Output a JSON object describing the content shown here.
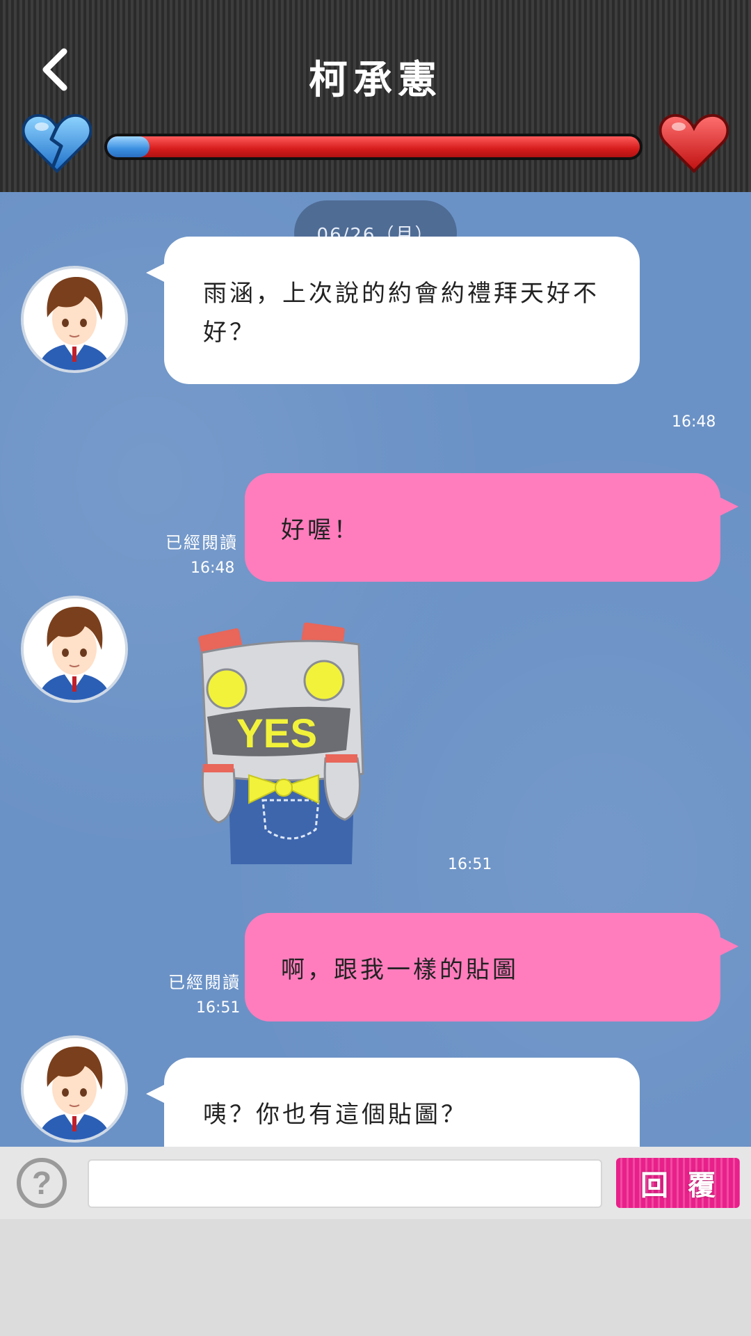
{
  "header": {
    "title": "柯承憲",
    "back_icon": "chevron-left-icon",
    "left_heart_icon": "broken-heart-icon",
    "right_heart_icon": "heart-icon",
    "affection_level_fraction": 0.08,
    "colors": {
      "affection_fill": "#3b8fe0",
      "affection_track": "#d61c1c"
    }
  },
  "chat": {
    "date": "06/26（月）",
    "messages": [
      {
        "from": "other",
        "text": "雨涵，上次說的約會約禮拜天好不好？",
        "time": "16:48"
      },
      {
        "from": "me",
        "text": "好喔！",
        "read": "已經閱讀",
        "time": "16:48"
      },
      {
        "from": "other",
        "sticker": "robot-yes-sticker",
        "sticker_text": "YES",
        "time": "16:51"
      },
      {
        "from": "me",
        "text": "啊，跟我一樣的貼圖",
        "read": "已經閱讀",
        "time": "16:51"
      },
      {
        "from": "other",
        "text": "咦？你也有這個貼圖？"
      }
    ],
    "colors": {
      "background": "#6b92c6",
      "my_bubble": "#ff7dbd",
      "their_bubble": "#ffffff"
    }
  },
  "input_bar": {
    "help_label": "?",
    "message_value": "",
    "reply_label": "回覆"
  }
}
